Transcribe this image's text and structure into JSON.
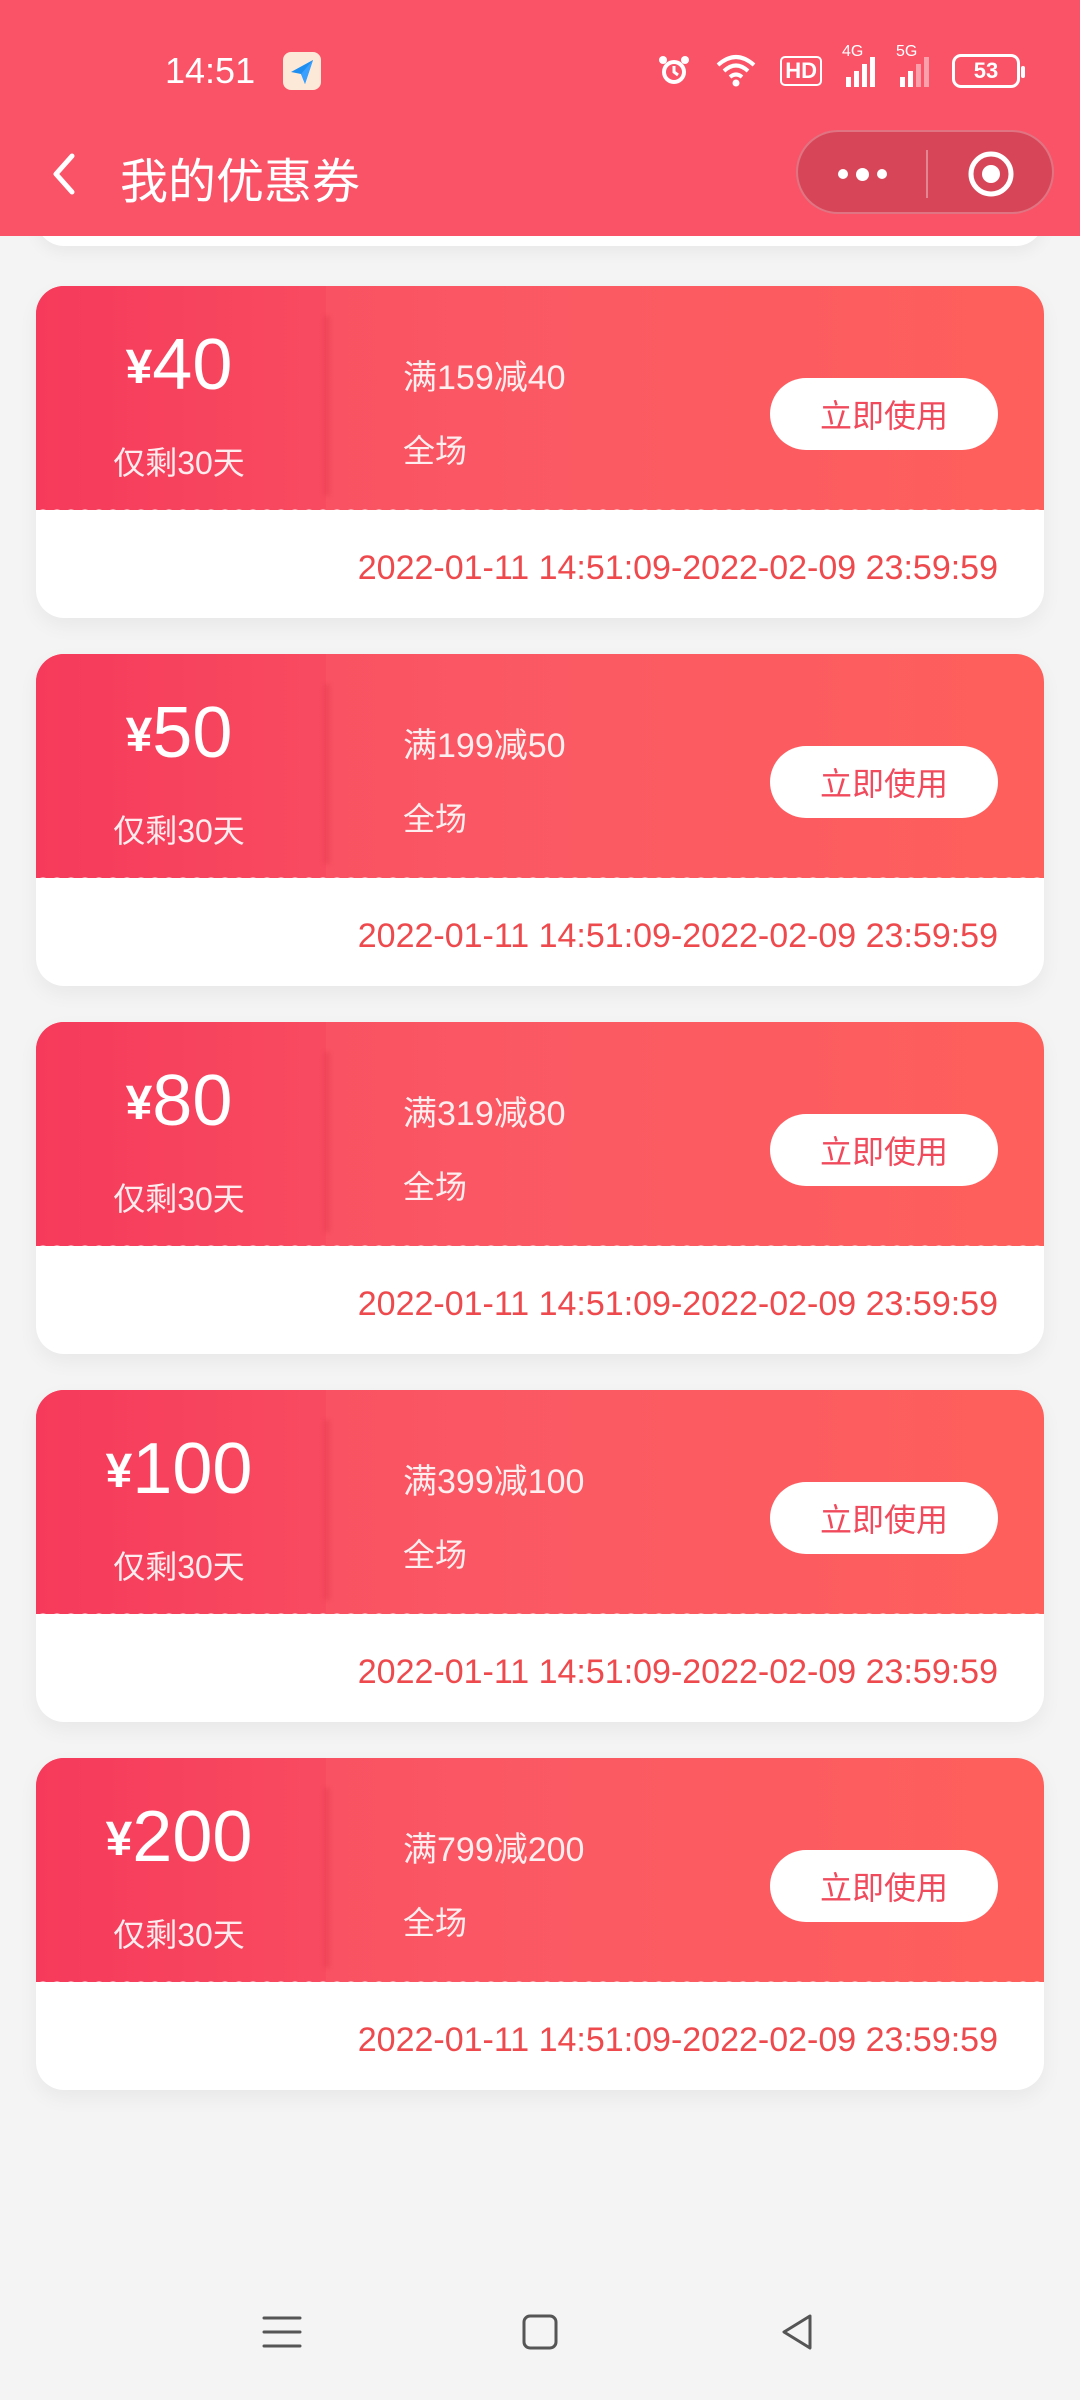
{
  "status_bar": {
    "time": "14:51",
    "battery": "53",
    "hd_label": "HD",
    "net_4g": "4G",
    "net_5g": "5G"
  },
  "nav": {
    "title": "我的优惠券"
  },
  "coupons": [
    {
      "currency": "¥",
      "amount": "40",
      "remaining": "仅剩30天",
      "condition": "满159减40",
      "scope": "全场",
      "button": "立即使用",
      "validity": "2022-01-11 14:51:09-2022-02-09 23:59:59"
    },
    {
      "currency": "¥",
      "amount": "50",
      "remaining": "仅剩30天",
      "condition": "满199减50",
      "scope": "全场",
      "button": "立即使用",
      "validity": "2022-01-11 14:51:09-2022-02-09 23:59:59"
    },
    {
      "currency": "¥",
      "amount": "80",
      "remaining": "仅剩30天",
      "condition": "满319减80",
      "scope": "全场",
      "button": "立即使用",
      "validity": "2022-01-11 14:51:09-2022-02-09 23:59:59"
    },
    {
      "currency": "¥",
      "amount": "100",
      "remaining": "仅剩30天",
      "condition": "满399减100",
      "scope": "全场",
      "button": "立即使用",
      "validity": "2022-01-11 14:51:09-2022-02-09 23:59:59"
    },
    {
      "currency": "¥",
      "amount": "200",
      "remaining": "仅剩30天",
      "condition": "满799减200",
      "scope": "全场",
      "button": "立即使用",
      "validity": "2022-01-11 14:51:09-2022-02-09 23:59:59"
    }
  ],
  "colors": {
    "header_bg": "#fa5267",
    "coupon_gradient_start": "#f63a5b",
    "coupon_gradient_end": "#fe5f5b",
    "validity_text": "#ee4a4e",
    "page_bg": "#f4f4f4"
  },
  "icons": {
    "back": "chevron-left-icon",
    "more": "more-dots-icon",
    "close": "target-close-icon",
    "sys_menu": "menu-lines-icon",
    "sys_home": "square-home-icon",
    "sys_back": "triangle-back-icon"
  }
}
